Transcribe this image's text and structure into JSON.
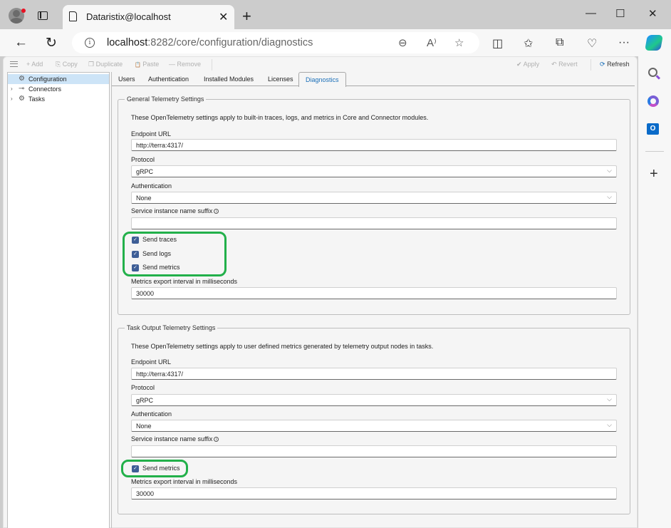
{
  "browser": {
    "tab_title": "Dataristix@localhost",
    "close_tab": "✕",
    "new_tab": "+",
    "url_host": "localhost",
    "url_rest": ":8282/core/configuration/diagnostics",
    "window_controls": {
      "minimize": "—",
      "maximize": "☐",
      "close": "✕"
    },
    "nav": {
      "back": "←",
      "reload": "↻"
    },
    "address_icons": {
      "zoom": "⊖",
      "read_aloud": "A⁾",
      "favorite": "☆"
    },
    "toolbar_icons": {
      "split": "◫",
      "favorites": "✩",
      "collections": "⧉",
      "health": "♡",
      "more": "···"
    },
    "sidebar": {
      "outlook_label": "O",
      "add": "+"
    }
  },
  "app_toolbar": {
    "add": "Add",
    "copy": "Copy",
    "duplicate": "Duplicate",
    "paste": "Paste",
    "remove": "Remove",
    "apply": "Apply",
    "revert": "Revert",
    "refresh": "Refresh",
    "icons": {
      "add": "+",
      "copy": "⎘",
      "duplicate": "❐",
      "paste": "📋",
      "remove": "—",
      "apply": "✔",
      "revert": "↶",
      "refresh": "⟳"
    }
  },
  "tree": [
    {
      "label": "Configuration",
      "icon": "⚙",
      "chevron": "",
      "selected": true
    },
    {
      "label": "Connectors",
      "icon": "⊸",
      "chevron": "›",
      "selected": false
    },
    {
      "label": "Tasks",
      "icon": "⚙",
      "chevron": "›",
      "selected": false
    }
  ],
  "tabs": [
    {
      "label": "Users",
      "active": false
    },
    {
      "label": "Authentication",
      "active": false
    },
    {
      "label": "Installed Modules",
      "active": false
    },
    {
      "label": "Licenses",
      "active": false
    },
    {
      "label": "Diagnostics",
      "active": true
    }
  ],
  "general": {
    "legend": "General Telemetry Settings",
    "description": "These OpenTelemetry settings apply to built-in traces, logs, and metrics in Core and Connector modules.",
    "endpoint_label": "Endpoint URL",
    "endpoint_value": "http://terra:4317/",
    "protocol_label": "Protocol",
    "protocol_value": "gRPC",
    "auth_label": "Authentication",
    "auth_value": "None",
    "suffix_label": "Service instance name suffix",
    "suffix_value": "",
    "send_traces": {
      "label": "Send traces",
      "checked": true
    },
    "send_logs": {
      "label": "Send logs",
      "checked": true
    },
    "send_metrics": {
      "label": "Send metrics",
      "checked": true
    },
    "interval_label": "Metrics export interval in milliseconds",
    "interval_value": "30000"
  },
  "task_output": {
    "legend": "Task Output Telemetry Settings",
    "description": "These OpenTelemetry settings apply to user defined metrics generated by telemetry output nodes in tasks.",
    "endpoint_label": "Endpoint URL",
    "endpoint_value": "http://terra:4317/",
    "protocol_label": "Protocol",
    "protocol_value": "gRPC",
    "auth_label": "Authentication",
    "auth_value": "None",
    "suffix_label": "Service instance name suffix",
    "suffix_value": "",
    "send_metrics": {
      "label": "Send metrics",
      "checked": true
    },
    "interval_label": "Metrics export interval in milliseconds",
    "interval_value": "30000"
  },
  "glyphs": {
    "check": "✓",
    "chevron_down": "⌵",
    "info": "i"
  },
  "colors": {
    "accent": "#1a6fb8",
    "checkbox": "#3e5e96",
    "highlight": "#22b04a",
    "selected_row": "#cde4f7"
  }
}
